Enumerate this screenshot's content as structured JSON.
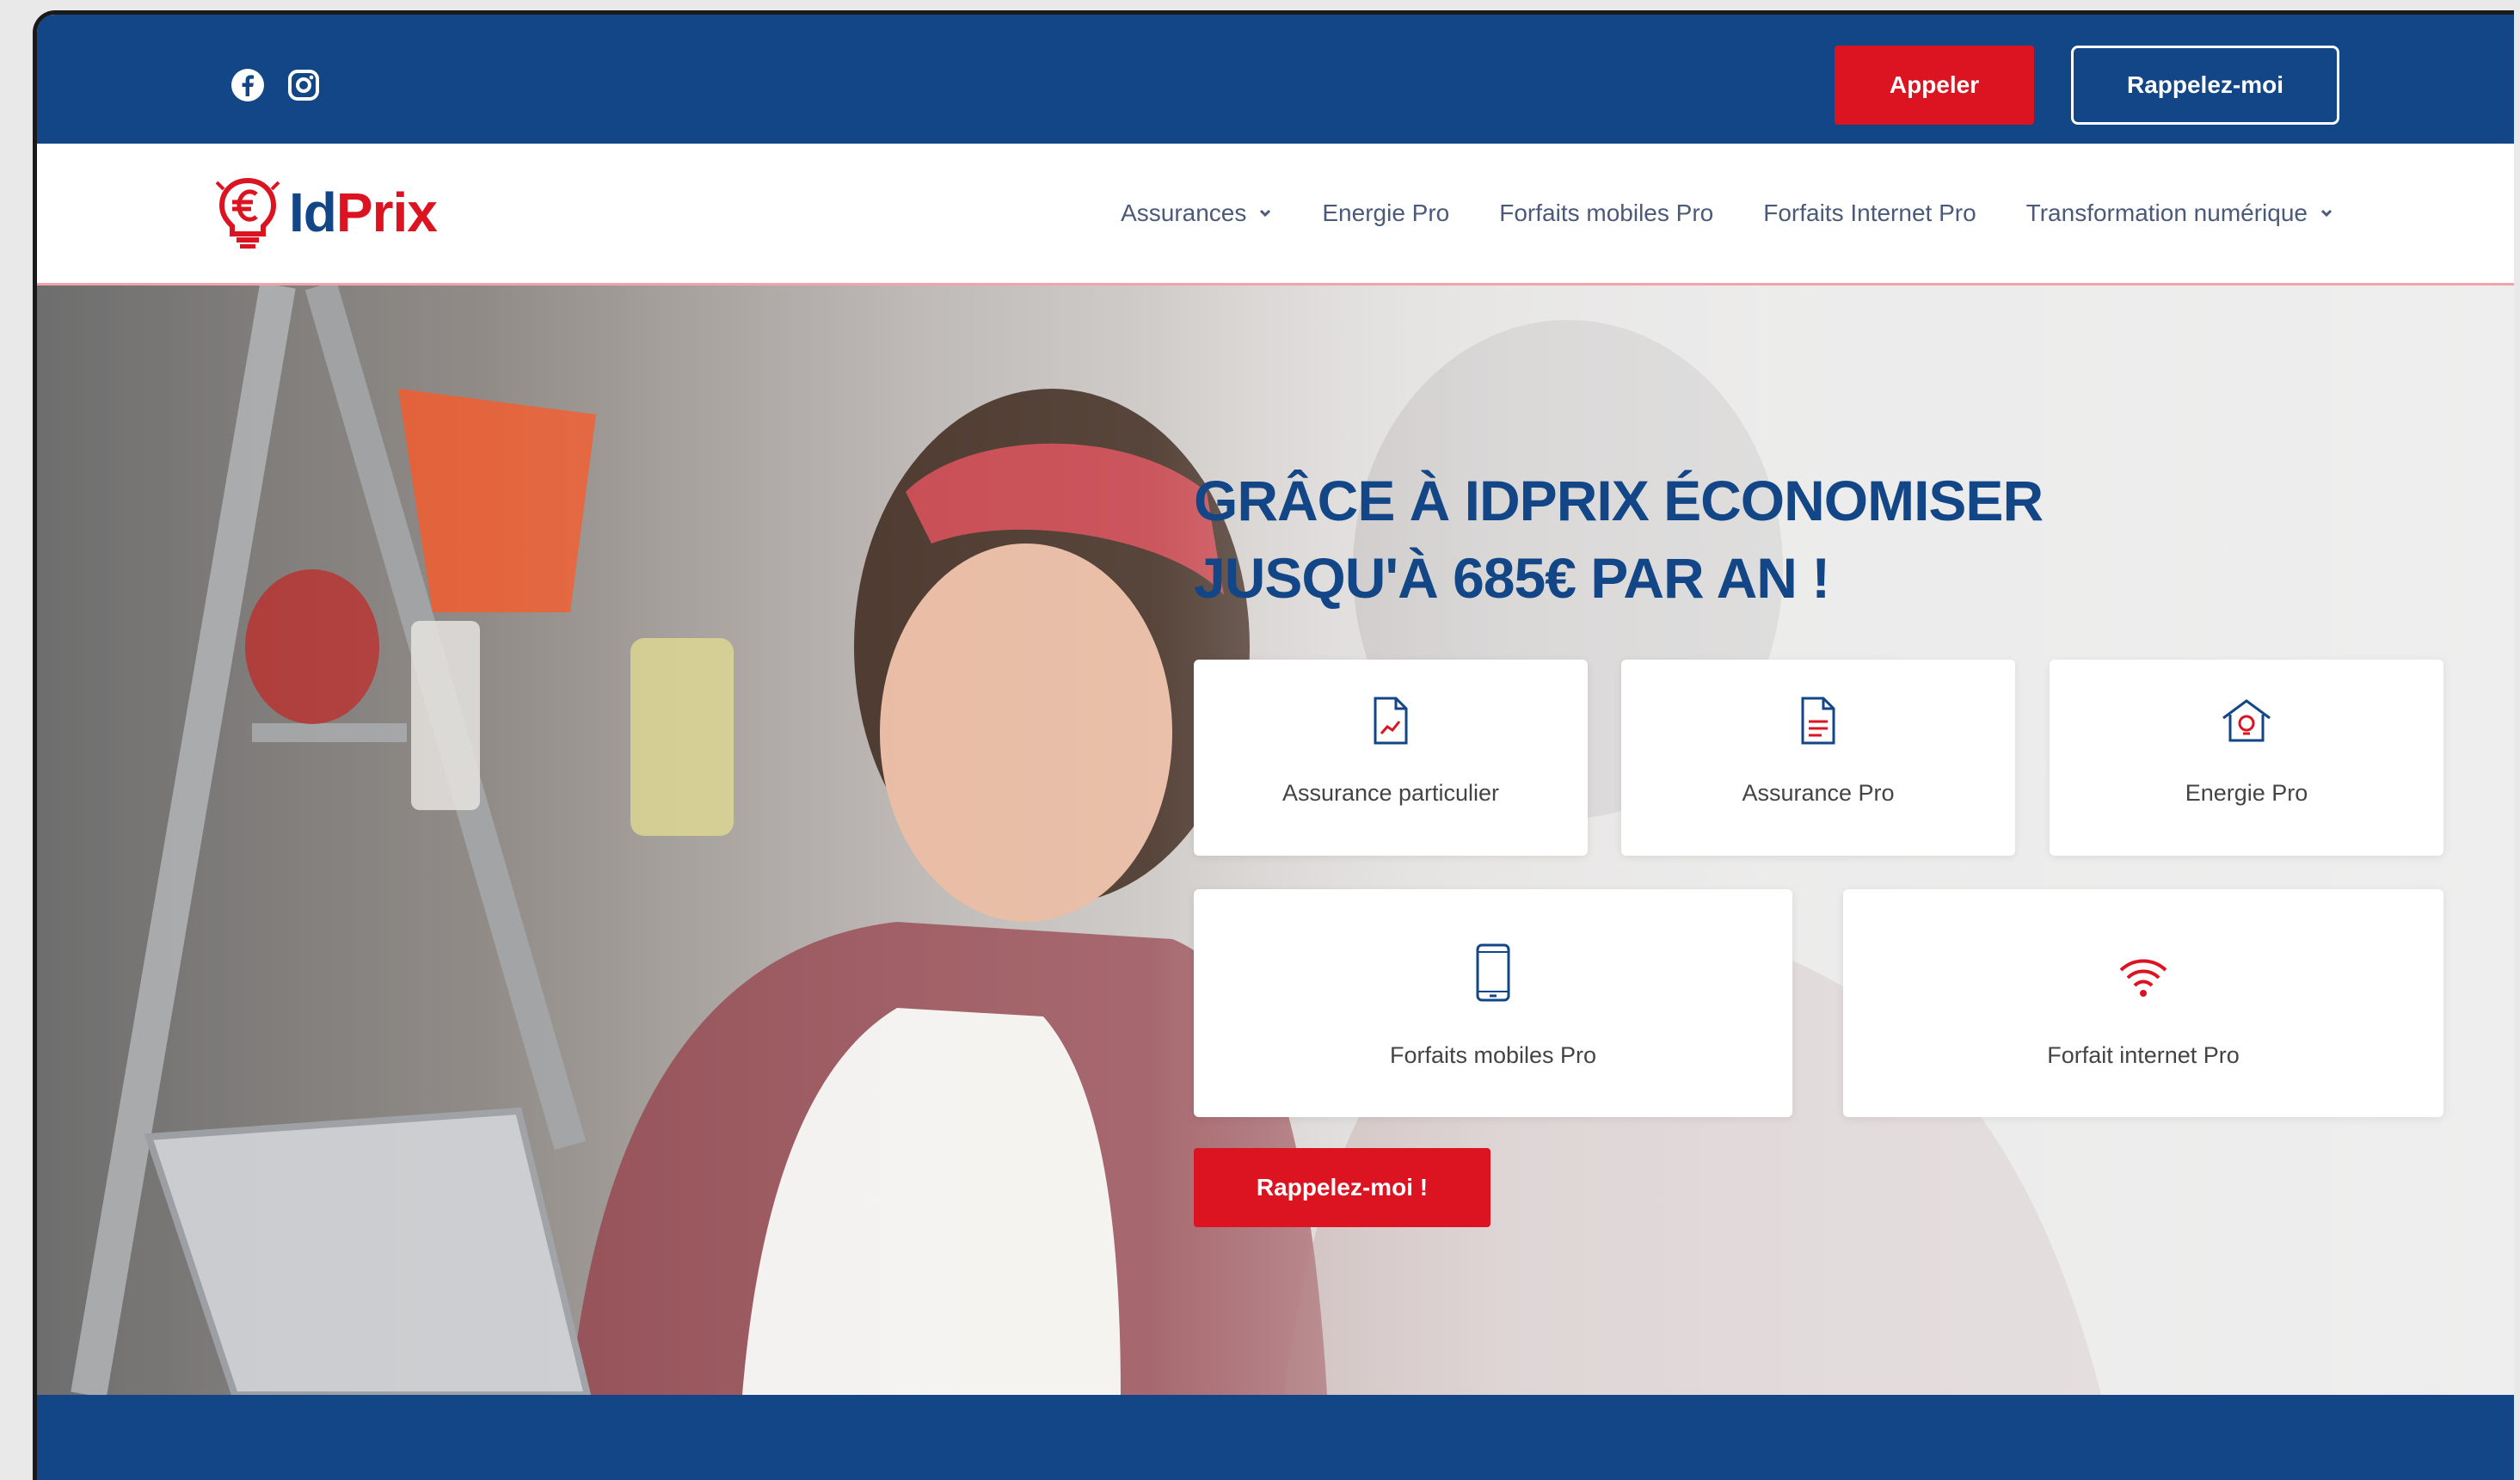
{
  "colors": {
    "brand_blue": "#134686",
    "brand_red": "#dc1421",
    "nav_text": "#4a5a78",
    "card_bg": "#ffffff"
  },
  "topbar": {
    "social_icons": [
      "facebook-icon",
      "instagram-icon"
    ],
    "call_button": "Appeler",
    "callback_button": "Rappelez-moi"
  },
  "logo": {
    "icon": "euro-lightbulb-icon",
    "text_id": "Id",
    "text_prix": "Prix"
  },
  "nav": {
    "items": [
      {
        "label": "Assurances",
        "has_dropdown": true
      },
      {
        "label": "Energie Pro",
        "has_dropdown": false
      },
      {
        "label": "Forfaits mobiles Pro",
        "has_dropdown": false
      },
      {
        "label": "Forfaits Internet Pro",
        "has_dropdown": false
      },
      {
        "label": "Transformation numérique",
        "has_dropdown": true
      }
    ]
  },
  "hero": {
    "headline_line1": "GRÂCE À IDPRIX ÉCONOMISER",
    "headline_line2": "JUSQU'À 685€ PAR AN !",
    "cards": [
      {
        "label": "Assurance particulier",
        "icon": "document-chart-icon"
      },
      {
        "label": "Assurance Pro",
        "icon": "document-list-icon"
      },
      {
        "label": "Energie Pro",
        "icon": "house-bulb-icon"
      },
      {
        "label": "Forfaits mobiles Pro",
        "icon": "smartphone-icon"
      },
      {
        "label": "Forfait internet Pro",
        "icon": "wifi-icon"
      }
    ],
    "cta_button": "Rappelez-moi !"
  }
}
